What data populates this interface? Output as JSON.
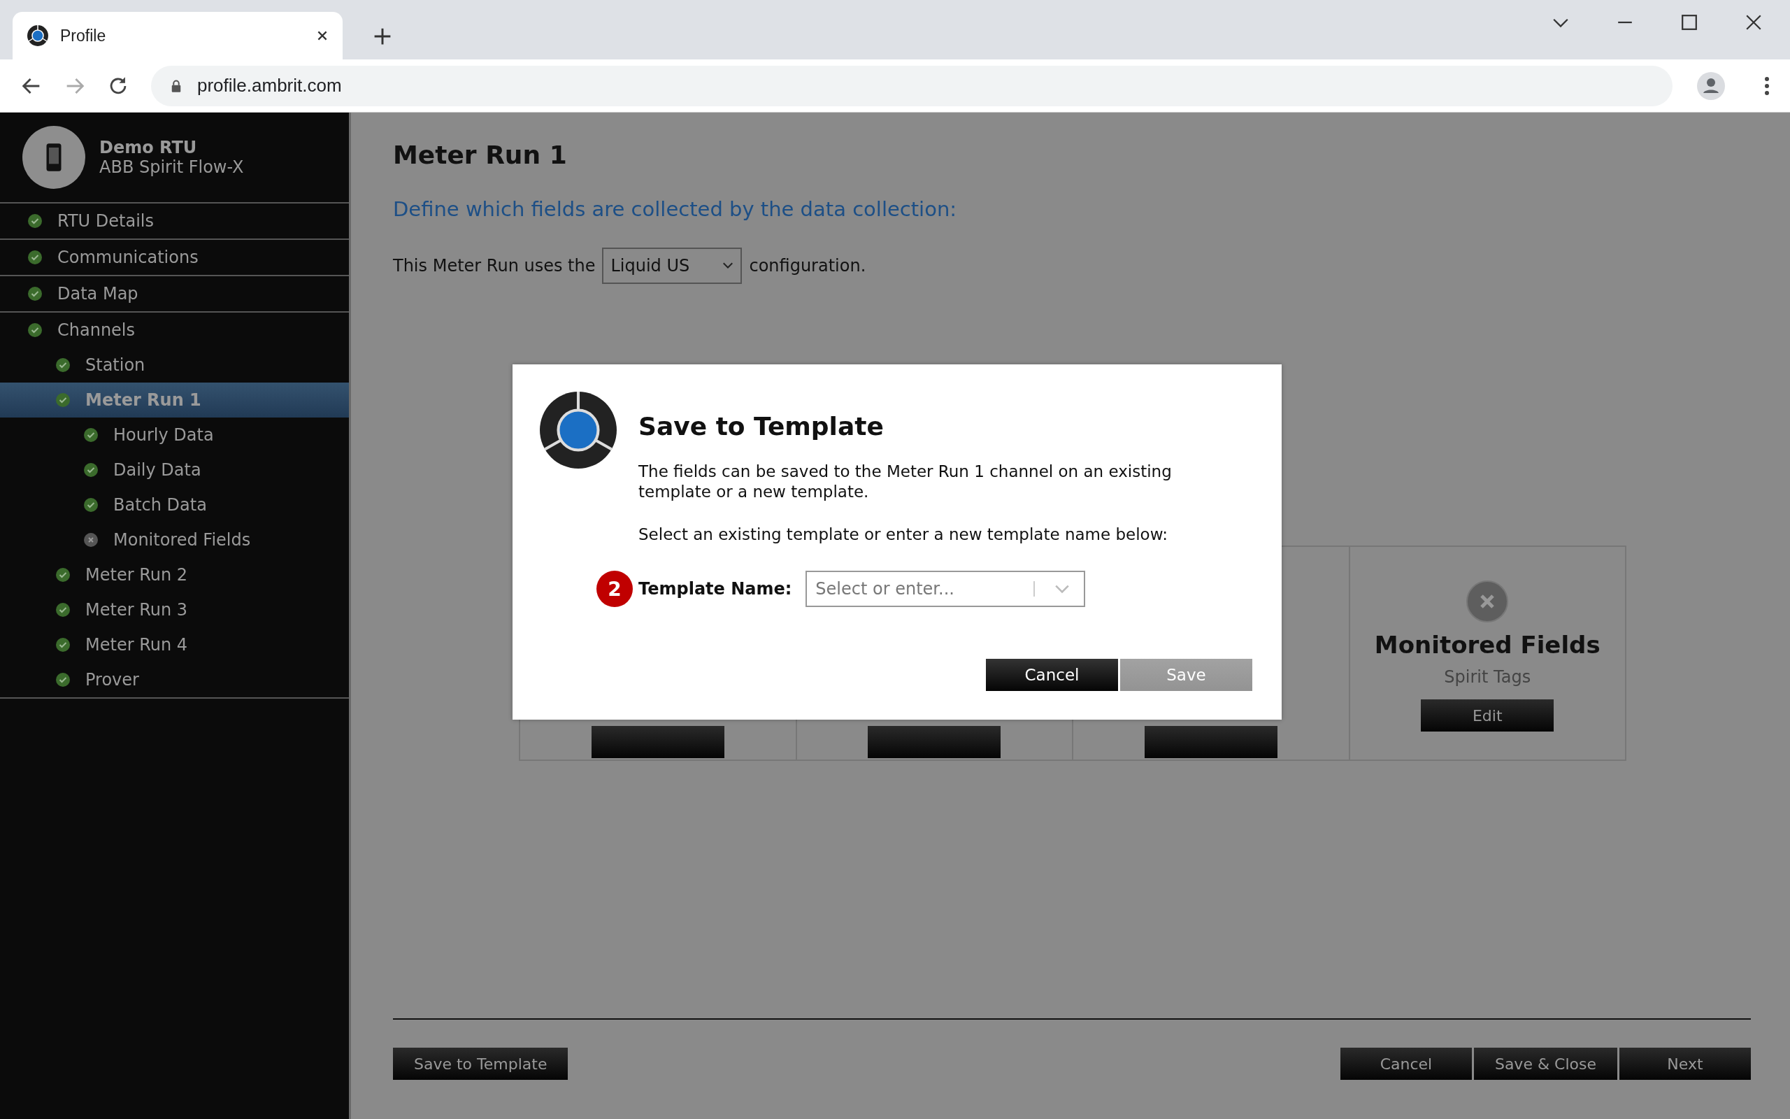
{
  "browser": {
    "tab_title": "Profile",
    "url": "profile.ambrit.com"
  },
  "sidebar": {
    "device_name": "Demo RTU",
    "device_model": "ABB Spirit Flow-X",
    "items": [
      {
        "label": "RTU Details",
        "complete": true,
        "selected": false
      },
      {
        "label": "Communications",
        "complete": true,
        "selected": false
      },
      {
        "label": "Data Map",
        "complete": true,
        "selected": false
      },
      {
        "label": "Channels",
        "complete": true,
        "selected": false,
        "children": [
          {
            "label": "Station",
            "complete": true,
            "selected": false
          },
          {
            "label": "Meter Run 1",
            "complete": true,
            "selected": true,
            "children": [
              {
                "label": "Hourly Data",
                "complete": true,
                "selected": false
              },
              {
                "label": "Daily Data",
                "complete": true,
                "selected": false
              },
              {
                "label": "Batch Data",
                "complete": true,
                "selected": false
              },
              {
                "label": "Monitored Fields",
                "complete": false,
                "selected": false
              }
            ]
          },
          {
            "label": "Meter Run 2",
            "complete": true,
            "selected": false
          },
          {
            "label": "Meter Run 3",
            "complete": true,
            "selected": false
          },
          {
            "label": "Meter Run 4",
            "complete": true,
            "selected": false
          },
          {
            "label": "Prover",
            "complete": true,
            "selected": false
          }
        ]
      }
    ]
  },
  "page": {
    "title": "Meter Run 1",
    "subtitle": "Define which fields are collected by the data collection:",
    "config_prefix": "This Meter Run uses the",
    "config_value": "Liquid US",
    "config_suffix": "configuration.",
    "card": {
      "title": "Monitored Fields",
      "subtitle": "Spirit Tags",
      "complete": false,
      "button": "Edit"
    }
  },
  "footer": {
    "left_buttons": [
      "Save to Template"
    ],
    "right_buttons": [
      "Cancel",
      "Save & Close",
      "Next"
    ]
  },
  "dialog": {
    "title": "Save to Template",
    "message": "The fields can be saved to the Meter Run 1 channel on an existing template or a new template.",
    "instruction": "Select an existing template or enter a new template name below:",
    "step": "2",
    "field_label": "Template Name:",
    "placeholder": "Select or enter...",
    "buttons": [
      {
        "label": "Cancel",
        "disabled": false
      },
      {
        "label": "Save",
        "disabled": true
      }
    ]
  }
}
